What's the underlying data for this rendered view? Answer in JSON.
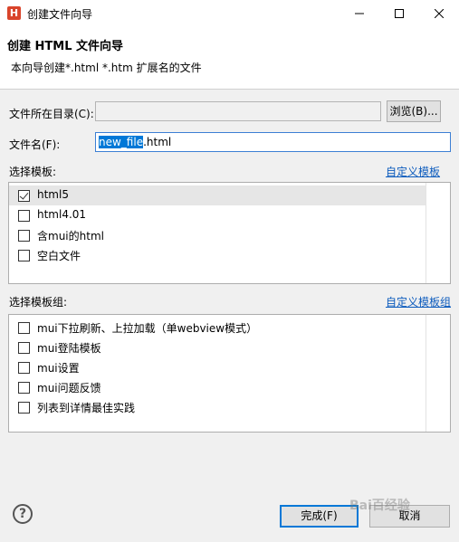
{
  "window": {
    "title": "创建文件向导",
    "icon_letter": "H"
  },
  "header": {
    "title": "创建 HTML 文件向导",
    "description": "本向导创建*.html *.htm 扩展名的文件"
  },
  "form": {
    "dir_label": "文件所在目录(C):",
    "dir_value": "",
    "browse_label": "浏览(B)...",
    "filename_label": "文件名(F):",
    "filename_selected": "new_file",
    "filename_suffix": ".html"
  },
  "templates": {
    "label": "选择模板:",
    "custom_link": "自定义模板",
    "items": [
      {
        "label": "html5",
        "checked": true,
        "selected": true
      },
      {
        "label": "html4.01",
        "checked": false
      },
      {
        "label": "含mui的html",
        "checked": false
      },
      {
        "label": "空白文件",
        "checked": false
      }
    ]
  },
  "template_groups": {
    "label": "选择模板组:",
    "custom_link": "自定义模板组",
    "items": [
      {
        "label": "mui下拉刷新、上拉加载（单webview模式）",
        "checked": false
      },
      {
        "label": "mui登陆模板",
        "checked": false
      },
      {
        "label": "mui设置",
        "checked": false
      },
      {
        "label": "mui问题反馈",
        "checked": false
      },
      {
        "label": "列表到详情最佳实践",
        "checked": false
      }
    ]
  },
  "footer": {
    "finish_label": "完成(F)",
    "cancel_label": "取消",
    "help_symbol": "?",
    "watermark": "Bai百经验"
  }
}
